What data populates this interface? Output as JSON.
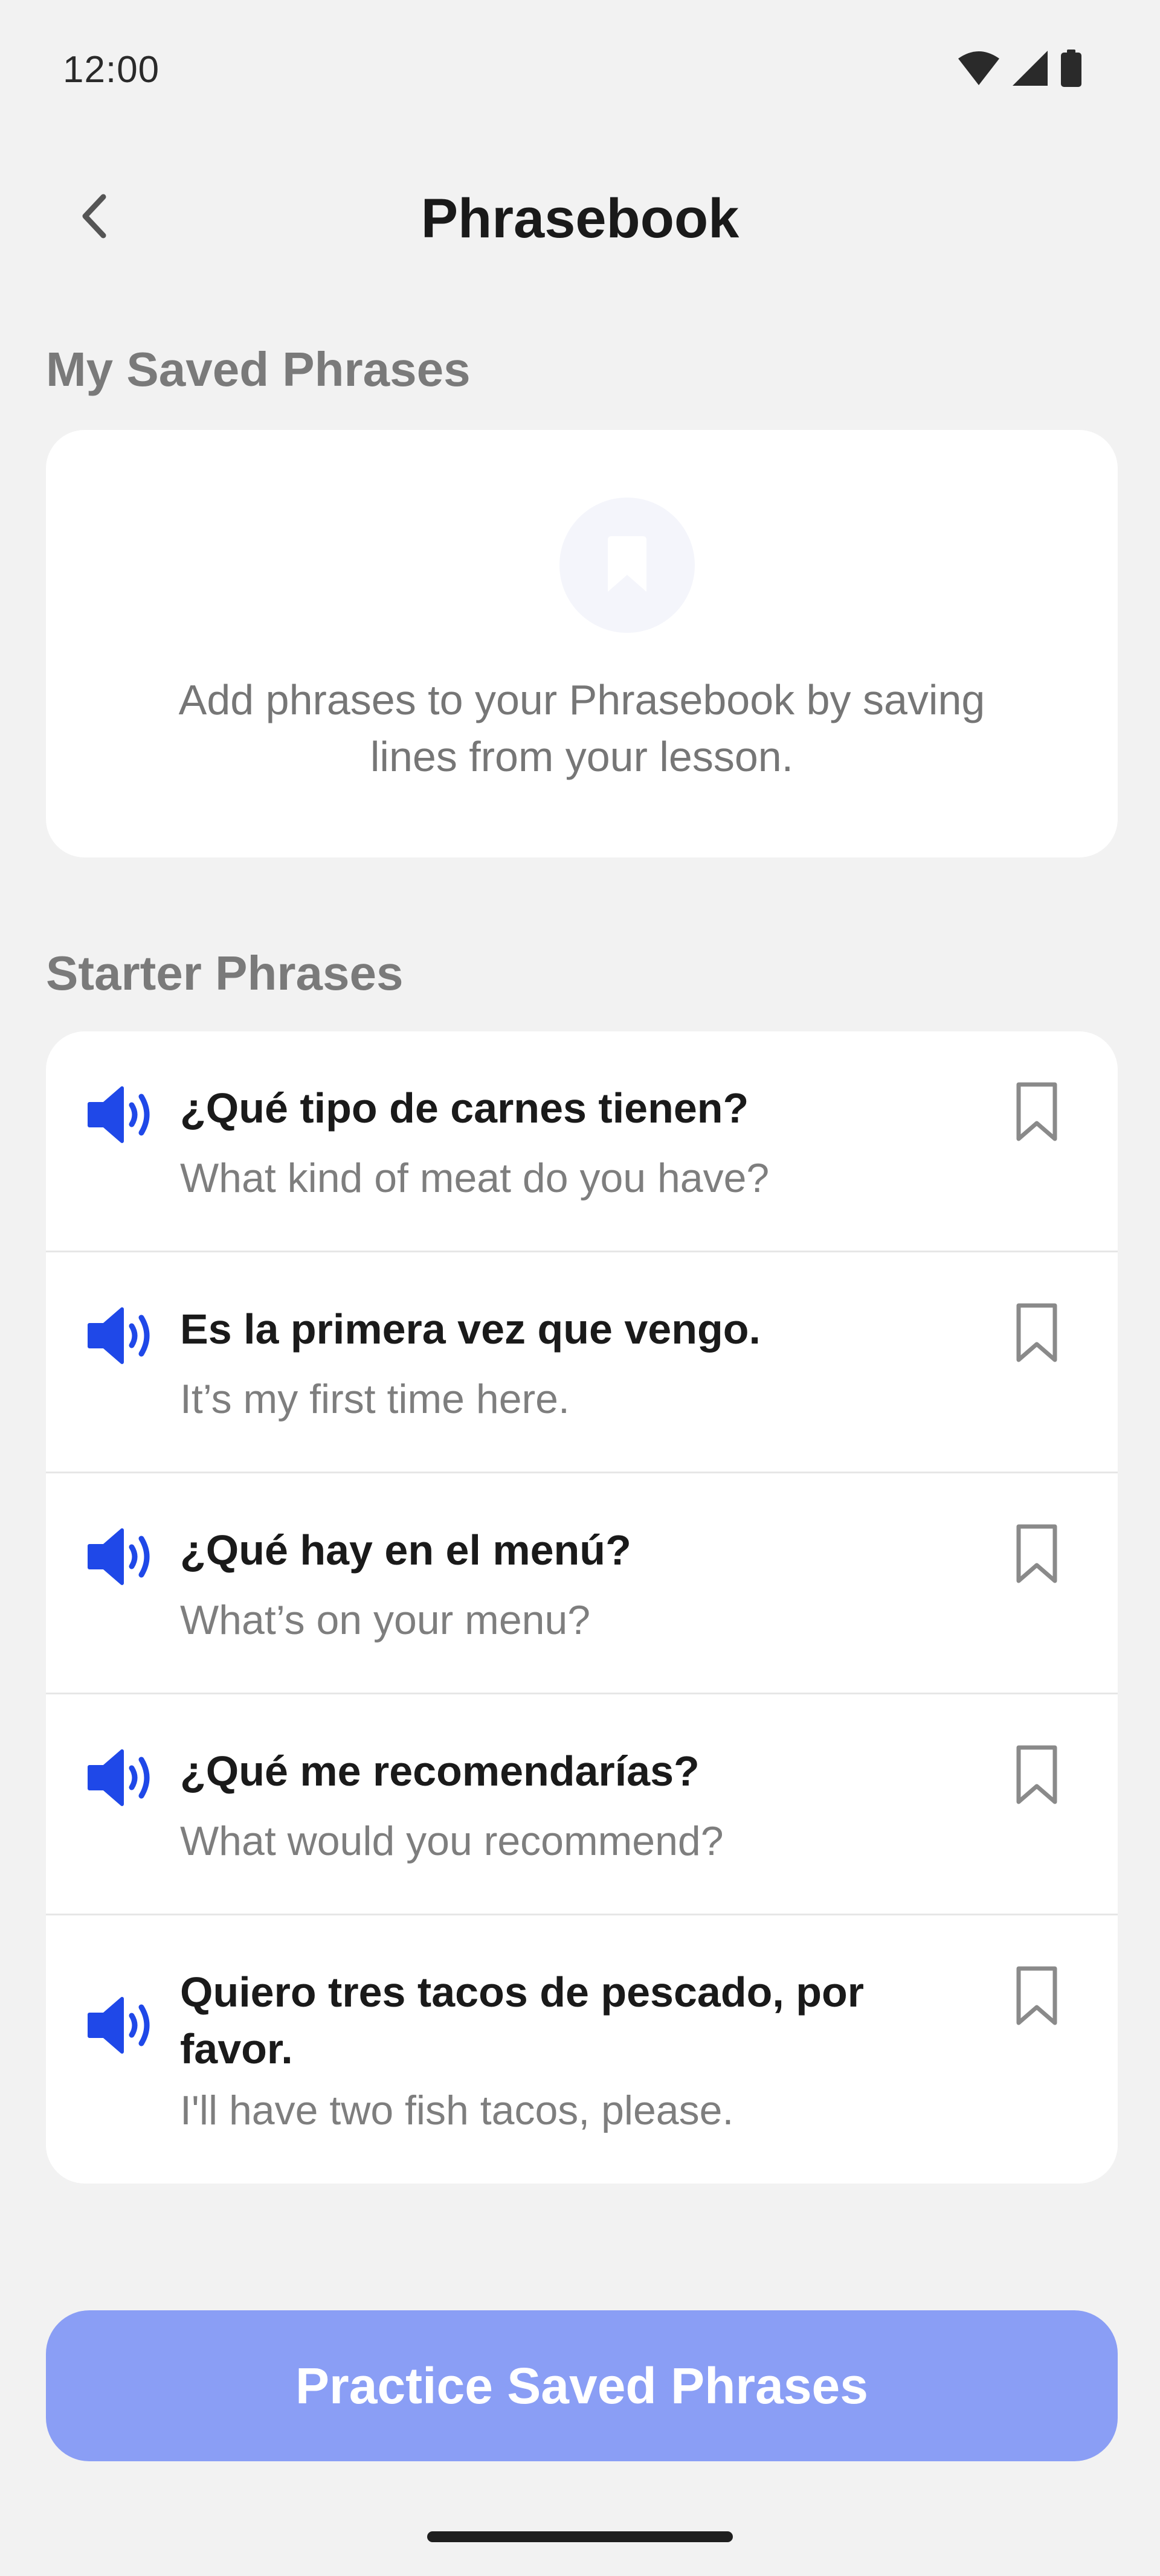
{
  "status_bar": {
    "time": "12:00",
    "icons": [
      "wifi-icon",
      "cell-signal-icon",
      "battery-icon"
    ]
  },
  "app_bar": {
    "back_icon": "chevron-left-icon",
    "title": "Phrasebook"
  },
  "saved_section": {
    "title": "My Saved Phrases",
    "empty_icon": "bookmark-icon",
    "empty_message": "Add phrases to your Phrasebook by saving lines from your lesson."
  },
  "starter_section": {
    "title": "Starter Phrases",
    "phrases": [
      {
        "spanish": "¿Qué tipo de carnes tienen?",
        "english": "What kind of meat do you have?"
      },
      {
        "spanish": "Es la primera vez que vengo.",
        "english": "It’s my first time here."
      },
      {
        "spanish": "¿Qué hay en el menú?",
        "english": "What’s on your menu?"
      },
      {
        "spanish": "¿Qué me recomendarías?",
        "english": "What would you recommend?"
      },
      {
        "spanish": "Quiero tres tacos de pescado, por favor.",
        "english": "I'll have two fish tacos, please."
      }
    ]
  },
  "cta": {
    "label": "Practice Saved Phrases"
  },
  "colors": {
    "background": "#f2f2f2",
    "card": "#ffffff",
    "accent_blue": "#1f48e8",
    "cta_background": "#8a9ef5",
    "section_title": "#7a7a7a",
    "secondary_text": "#7e7e7e",
    "bookmark_outline": "#8a8a8a"
  }
}
